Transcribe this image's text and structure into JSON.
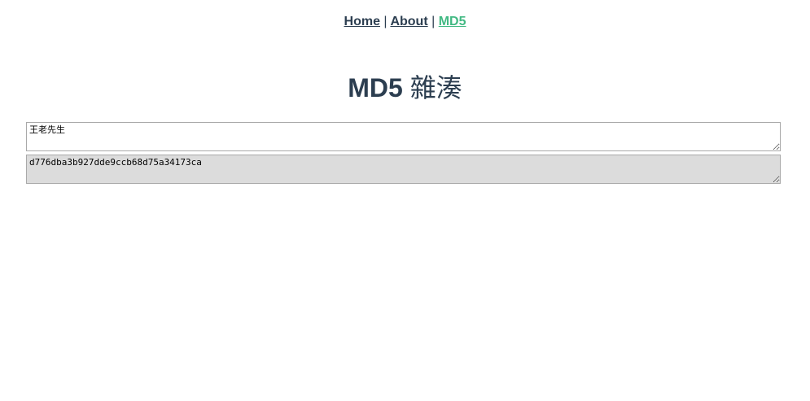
{
  "nav": {
    "items": [
      {
        "label": "Home"
      },
      {
        "label": "About"
      },
      {
        "label": "MD5"
      }
    ],
    "separator": "|",
    "active_color": "#42b983",
    "text_color": "#2c3e50"
  },
  "page": {
    "title_main": "MD5",
    "title_sub": "雜湊"
  },
  "form": {
    "input_value": "王老先生",
    "output_value": "d776dba3b927dde9ccb68d75a34173ca",
    "output_background": "#dcdcdc"
  }
}
